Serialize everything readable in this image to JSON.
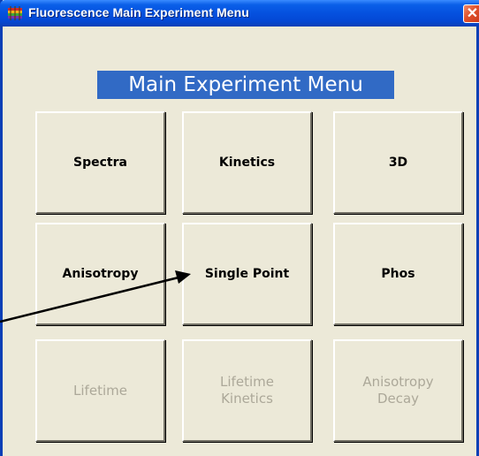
{
  "window": {
    "title": "Fluorescence Main Experiment Menu",
    "close_label": "✕"
  },
  "menu": {
    "heading": "Main Experiment Menu",
    "buttons": [
      {
        "label": "Spectra",
        "enabled": true
      },
      {
        "label": "Kinetics",
        "enabled": true
      },
      {
        "label": "3D",
        "enabled": true
      },
      {
        "label": "Anisotropy",
        "enabled": true
      },
      {
        "label": "Single Point",
        "enabled": true
      },
      {
        "label": "Phos",
        "enabled": true
      },
      {
        "label": "Lifetime",
        "enabled": false
      },
      {
        "label": "Lifetime\nKinetics",
        "enabled": false
      },
      {
        "label": "Anisotropy\nDecay",
        "enabled": false
      }
    ]
  },
  "colors": {
    "titlebar": "#0551df",
    "heading_bg": "#316ac5",
    "face": "#ece9d8",
    "disabled_text": "#aca899",
    "close": "#e0502a"
  },
  "icons": {
    "app": "spectrum-bars-icon",
    "close": "close-icon",
    "pointer": "arrow-annotation"
  }
}
